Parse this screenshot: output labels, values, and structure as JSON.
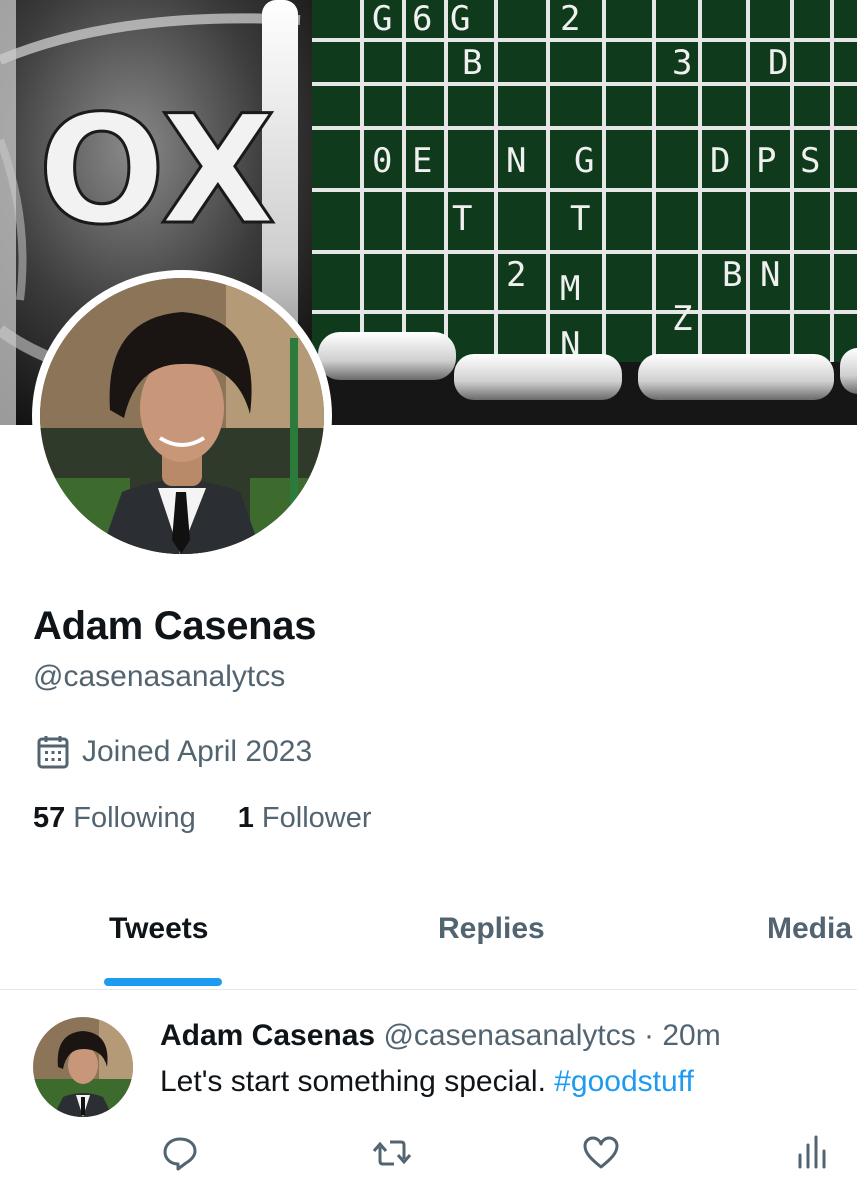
{
  "banner": {
    "logo_text": "OX",
    "grid_letters": [
      "G",
      "6",
      "G",
      "2",
      "B",
      "3",
      "D",
      "0",
      "E",
      "N",
      "G",
      "D",
      "P",
      "S",
      "T",
      "2",
      "M",
      "B",
      "N",
      "Z",
      "T",
      "N"
    ]
  },
  "profile": {
    "display_name": "Adam Casenas",
    "handle": "@casenasanalytcs",
    "joined": "Joined April 2023",
    "following_count": "57",
    "following_label": "Following",
    "followers_count": "1",
    "followers_label": "Follower"
  },
  "tabs": [
    {
      "label": "Tweets",
      "active": true
    },
    {
      "label": "Replies",
      "active": false
    },
    {
      "label": "Media",
      "active": false
    }
  ],
  "tweet": {
    "author_name": "Adam Casenas",
    "meta": "@casenasanalytcs · 20m",
    "text": "Let's start something special. ",
    "hashtag": "#goodstuff"
  },
  "icons": {
    "calendar": "calendar-icon",
    "reply": "reply-icon",
    "retweet": "retweet-icon",
    "like": "heart-icon",
    "views": "views-icon"
  },
  "colors": {
    "accent": "#1d9bf0",
    "text_primary": "#0f1419",
    "text_secondary": "#536471",
    "banner_green": "#0f3b1c"
  }
}
